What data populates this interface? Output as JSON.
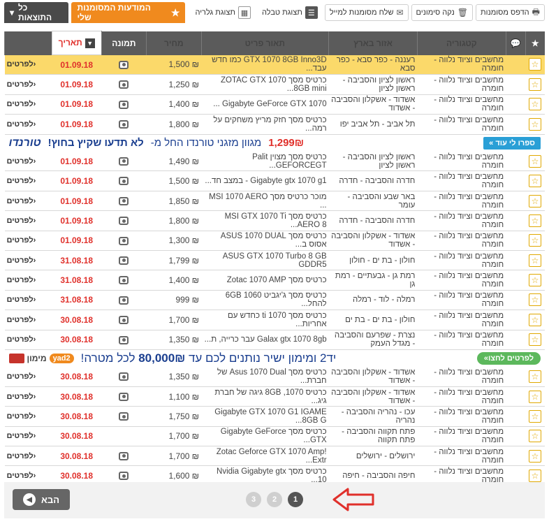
{
  "toolbar": {
    "print_label": "הדפס מסומנות",
    "clear_label": "נקה סימונים",
    "send_label": "שלח מסומנות למייל",
    "table_view_label": "תצוגת טבלה",
    "gallery_view_label": "תצוגת גלריה",
    "favorites_label": "המודעות המסומנות שלי",
    "all_results_label": "כל התוצאות"
  },
  "columns": {
    "category": "קטגוריה",
    "area": "אזור בארץ",
    "description": "תאור פריט",
    "price": "מחיר",
    "image": "תמונה",
    "date": "תאריך"
  },
  "rows_a": [
    {
      "category": "מחשבים וציוד נלווה - חומרה",
      "area": "רעננה - כפר סבא - כפר סבא",
      "description": "GTX 1070 8GB Inno3D כמו חדש עבד...",
      "price": "₪ 1,500",
      "date": "01.09.18",
      "more": "לפרטים"
    },
    {
      "category": "מחשבים וציוד נלווה - חומרה",
      "area": "ראשון לציון והסביבה - ראשון לציון",
      "description": "כרטיס מסך ZOTAC GTX 1070 8GB mini...",
      "price": "₪ 1,250",
      "date": "01.09.18",
      "more": "לפרטים"
    },
    {
      "category": "מחשבים וציוד נלווה - חומרה",
      "area": "אשדוד - אשקלון והסביבה - אשדוד",
      "description": "Gigabyte GeForce GTX 1070 ...",
      "price": "₪ 1,400",
      "date": "01.09.18",
      "more": "לפרטים"
    },
    {
      "category": "מחשבים וציוד נלווה - חומרה",
      "area": "תל אביב - תל אביב יפו",
      "description": "כרטיס מסך חזק מריץ משחקים על רמה...",
      "price": "₪ 1,800",
      "date": "01.09.18",
      "more": "לפרטים"
    }
  ],
  "ad1": {
    "brand": "טורנדו",
    "headline": "לא תדעו שקיץ בחוץ!",
    "text": "מגוון מזגני טורנדו החל מ-",
    "price": "1,299₪",
    "cta": "ספרו לי עוד »"
  },
  "rows_b": [
    {
      "category": "מחשבים וציוד נלווה - חומרה",
      "area": "ראשון לציון והסביבה - ראשון לציון",
      "description": "כרטיס מסך מצוין Palit GEFORCEGT...",
      "price": "₪ 1,490",
      "date": "01.09.18",
      "more": "לפרטים"
    },
    {
      "category": "מחשבים וציוד נלווה - חומרה",
      "area": "חדרה והסביבה - חדרה",
      "description": "Gigabyte gtx 1070 g1 - במצב חד...",
      "price": "₪ 1,500",
      "date": "01.09.18",
      "more": "לפרטים"
    },
    {
      "category": "מחשבים וציוד נלווה - חומרה",
      "area": "באר שבע והסביבה - עומר",
      "description": "מוכר כרטיס מסך MSI 1070 AERO ...",
      "price": "₪ 1,850",
      "date": "01.09.18",
      "more": "לפרטים"
    },
    {
      "category": "מחשבים וציוד נלווה - חומרה",
      "area": "חדרה והסביבה - חדרה",
      "description": "כרטיס מסך MSI GTX 1070 Ti AERO 8...",
      "price": "₪ 1,800",
      "date": "01.09.18",
      "more": "לפרטים"
    },
    {
      "category": "מחשבים וציוד נלווה - חומרה",
      "area": "אשדוד - אשקלון והסביבה - אשדוד",
      "description": "כרטיס מסך ASUS 1070 DUAL אסוס ב...",
      "price": "₪ 1,300",
      "date": "01.09.18",
      "more": "לפרטים"
    },
    {
      "category": "מחשבים וציוד נלווה - חומרה",
      "area": "חולון - בת ים - חולון",
      "description": "ASUS GTX 1070 Turbo 8 GB GDDR5",
      "price": "₪ 1,799",
      "date": "31.08.18",
      "more": "לפרטים"
    },
    {
      "category": "מחשבים וציוד נלווה - חומרה",
      "area": "רמת גן - גבעתיים - רמת גן",
      "description": "כרטיס מסך Zotac 1070 AMP",
      "price": "₪ 1,400",
      "date": "31.08.18",
      "more": "לפרטים"
    },
    {
      "category": "מחשבים וציוד נלווה - חומרה",
      "area": "רמלה - לוד - רמלה",
      "description": "כרטיס מסך ג'יגביט 1060 6GB להחל...",
      "price": "₪ 999",
      "date": "31.08.18",
      "more": "לפרטים"
    },
    {
      "category": "מחשבים וציוד נלווה - חומרה",
      "area": "חולון - בת ים - בת ים",
      "description": "כרטיס מסך 1070 ti כחדש עם אחריות...",
      "price": "₪ 1,700",
      "date": "30.08.18",
      "more": "לפרטים"
    },
    {
      "category": "מחשבים וציוד נלווה - חומרה",
      "area": "נצרת - שפרעם והסביבה - מגדל העמק",
      "description": "Galax gtx 1070 8gb עבר כרייה, ת...",
      "price": "₪ 1,350",
      "date": "30.08.18",
      "more": "לפרטים"
    }
  ],
  "ad2": {
    "brand": "מימון",
    "yad2": "yad2",
    "text_pre": "יד2 ומימון ישיר נותנים לכם עד",
    "amount": "80,000₪",
    "text_post": "לכל מטרה!",
    "cta": "לפרטים לחצו»"
  },
  "rows_c": [
    {
      "category": "מחשבים וציוד נלווה - חומרה",
      "area": "אשדוד - אשקלון והסביבה - אשדוד",
      "description": "כרטיס מסך Asus 1070 Dual של חברת...",
      "price": "₪ 1,350",
      "date": "30.08.18",
      "more": "לפרטים",
      "img": true
    },
    {
      "category": "מחשבים וציוד נלווה - חומרה",
      "area": "אשדוד - אשקלון והסביבה - אשדוד",
      "description": "כרטיס 1070, 8GB גיגה של חברת גיג...",
      "price": "₪ 1,100",
      "date": "30.08.18",
      "more": "לפרטים",
      "img": true
    },
    {
      "category": "מחשבים וציוד נלווה - חומרה",
      "area": "עכו - נהריה והסביבה - נהריה",
      "description": "Gigabyte GTX 1070 G1 IGAME 8GB G...",
      "price": "₪ 1,750",
      "date": "30.08.18",
      "more": "לפרטים",
      "img": true
    },
    {
      "category": "מחשבים וציוד נלווה - חומרה",
      "area": "פתח תקווה והסביבה - פתח תקווה",
      "description": "כרטיס מסך Gigabyte GeForce GTX...",
      "price": "₪ 1,700",
      "date": "30.08.18",
      "more": "לפרטים",
      "img": false
    },
    {
      "category": "מחשבים וציוד נלווה - חומרה",
      "area": "ירושלים - ירושלים",
      "description": "Zotac Geforce GTX 1070 Amp! Extr...",
      "price": "₪ 1,700",
      "date": "30.08.18",
      "more": "לפרטים",
      "img": true
    },
    {
      "category": "מחשבים וציוד נלווה - חומרה",
      "area": "חיפה והסביבה - חיפה",
      "description": "כרטיס מסך Nvidia Gigabyte gtx 10...",
      "price": "₪ 1,600",
      "date": "30.08.18",
      "more": "לפרטים",
      "img": true
    }
  ],
  "pagination": {
    "next_label": "הבא",
    "pages": [
      "3",
      "2",
      "1"
    ],
    "current": "1"
  },
  "colors": {
    "accent_orange": "#f08a1e",
    "header_gray": "#5b5b5b",
    "highlight_row": "#fbd96a",
    "date_red": "#e0302b",
    "annotation_arrow": "#e0302b"
  }
}
